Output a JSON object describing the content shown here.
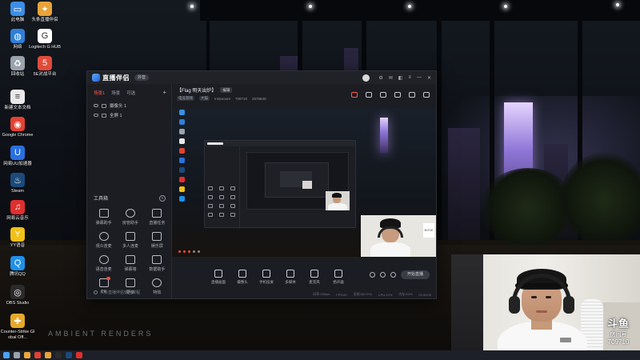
{
  "desktop": {
    "icons": [
      {
        "label": "此电脑",
        "color": "#3b8fe6",
        "glyph": "▭"
      },
      {
        "label": "头条直播伴侣",
        "color": "#e8a43a",
        "glyph": "✦"
      },
      {
        "label": "网络",
        "color": "#2f7fd9",
        "glyph": "◍"
      },
      {
        "label": "Logitech G HUB",
        "color": "#ffffff",
        "glyph": "G"
      },
      {
        "label": "回收站",
        "color": "#9aa3ad",
        "glyph": "♻"
      },
      {
        "label": "5E对战平台",
        "color": "#e14b3b",
        "glyph": "5"
      },
      {
        "label": "新建文本文档",
        "color": "#e9e9e9",
        "glyph": "≡"
      },
      {
        "label": "Google Chrome",
        "color": "#e34133",
        "glyph": "◉"
      },
      {
        "label": "网易UU加速器",
        "color": "#2a6fe0",
        "glyph": "U"
      },
      {
        "label": "Steam",
        "color": "#1b4a7a",
        "glyph": "♨"
      },
      {
        "label": "网易云音乐",
        "color": "#e02f2f",
        "glyph": "♫"
      },
      {
        "label": "YY语音",
        "color": "#f2c018",
        "glyph": "Y"
      },
      {
        "label": "腾讯QQ",
        "color": "#1e90e8",
        "glyph": "Q"
      },
      {
        "label": "OBS Studio",
        "color": "#2b2b2b",
        "glyph": "◎"
      },
      {
        "label": "Counter-Strike Global Off...",
        "color": "#e6a82a",
        "glyph": "✚"
      }
    ],
    "watermark": "AMBIENT RENDERS"
  },
  "app": {
    "logo_text": "直播伴侣",
    "version_pill": "抖音",
    "panel_tabs": [
      {
        "label": "场景1",
        "active": true
      },
      {
        "label": "场景",
        "active": false
      },
      {
        "label": "可选",
        "active": false
      }
    ],
    "add_label": "+",
    "scenes": [
      {
        "label": "摄像头 1",
        "icon": "cam"
      },
      {
        "label": "全屏 1",
        "icon": "screen"
      }
    ],
    "tools_label": "工具箱",
    "tools": [
      {
        "label": "弹幕助手",
        "hot": false,
        "shape": "box"
      },
      {
        "label": "房管助手",
        "hot": false,
        "shape": "circle"
      },
      {
        "label": "直播任务",
        "hot": false,
        "shape": "box"
      },
      {
        "label": "观众连麦",
        "hot": false,
        "shape": "circle"
      },
      {
        "label": "多人连麦",
        "hot": false,
        "shape": "box"
      },
      {
        "label": "娱乐屏",
        "hot": false,
        "shape": "box"
      },
      {
        "label": "语音连麦",
        "hot": false,
        "shape": "circle"
      },
      {
        "label": "弹幕墙",
        "hot": false,
        "shape": "box"
      },
      {
        "label": "数据助手",
        "hot": false,
        "shape": "box"
      },
      {
        "label": "PK",
        "hot": true,
        "shape": "box"
      },
      {
        "label": "更多",
        "hot": false,
        "shape": "box"
      },
      {
        "label": "特效",
        "hot": false,
        "shape": "circle"
      }
    ],
    "footer_text": "头条直播伴侣使用教程",
    "stream": {
      "title": "【Flag 明天出炉】",
      "edit_label": "编辑",
      "tags": [
        "电竞游戏",
        "大猫"
      ],
      "meta": [
        "Instaroom",
        "709710",
        "2578848"
      ]
    },
    "bottom_actions": [
      {
        "label": "直播画面"
      },
      {
        "label": "摄像头"
      },
      {
        "label": "手机投屏"
      },
      {
        "label": "多媒体"
      },
      {
        "label": "麦克风"
      },
      {
        "label": "扬声器"
      }
    ],
    "start_label": "开始直播",
    "status": [
      "码率:2Mbps",
      "FPS:60",
      "丢帧:0(0.0%)",
      "CPU:12%",
      "内存:54%",
      "00:00:00"
    ]
  },
  "webcam": {
    "room_logo": "斗鱼",
    "room_label": "房间号",
    "room_number": "709710"
  },
  "preview_cam": {
    "brand_box_text": "BOSE"
  }
}
